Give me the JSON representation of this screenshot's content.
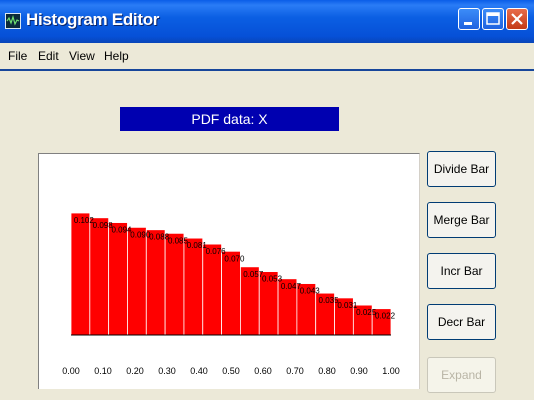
{
  "window": {
    "title": "Histogram Editor",
    "controls": [
      "minimize-icon",
      "maximize-icon",
      "close-icon"
    ]
  },
  "menu": {
    "items": [
      {
        "label": "File"
      },
      {
        "label": "Edit"
      },
      {
        "label": "View"
      },
      {
        "label": "Help"
      }
    ]
  },
  "header": {
    "label": "PDF data:  X"
  },
  "buttons": {
    "divide": "Divide Bar",
    "merge": "Merge Bar",
    "incr": "Incr Bar",
    "decr": "Decr Bar",
    "expand": "Expand"
  },
  "chart_data": {
    "type": "bar",
    "bar_color": "#ff0000",
    "x_ticks": [
      "0.00",
      "0.10",
      "0.20",
      "0.30",
      "0.40",
      "0.50",
      "0.60",
      "0.70",
      "0.80",
      "0.90",
      "1.00"
    ],
    "values": [
      0.102,
      0.098,
      0.094,
      0.09,
      0.088,
      0.085,
      0.081,
      0.076,
      0.07,
      0.057,
      0.053,
      0.047,
      0.043,
      0.035,
      0.031,
      0.025,
      0.022
    ],
    "value_labels": [
      "0.102",
      "0.098",
      "0.094",
      "0.090",
      "0.088",
      "0.085",
      "0.081",
      "0.076",
      "0.070",
      "0.057",
      "0.053",
      "0.047",
      "0.043",
      "0.035",
      "0.031",
      "0.025",
      "0.022"
    ],
    "xlim": [
      0,
      1
    ],
    "ylim": [
      0,
      0.102
    ]
  }
}
